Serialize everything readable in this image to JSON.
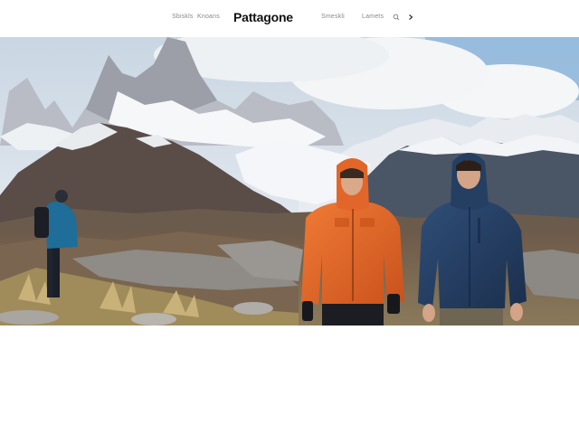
{
  "header": {
    "brand": "Pattagone",
    "nav_left": [
      "Sbiskls",
      "Knoans"
    ],
    "nav_right": [
      "Smeskli",
      "Lamets"
    ]
  },
  "icons": {
    "search": "search-icon",
    "next": "chevron-right-icon"
  },
  "hero": {
    "image_alt": "hero-photo"
  },
  "colors": {
    "jacket_orange": "#e2662a",
    "jacket_navy": "#253f63",
    "jacket_teal": "#1f6e99",
    "sky": "#8fb7dc"
  }
}
